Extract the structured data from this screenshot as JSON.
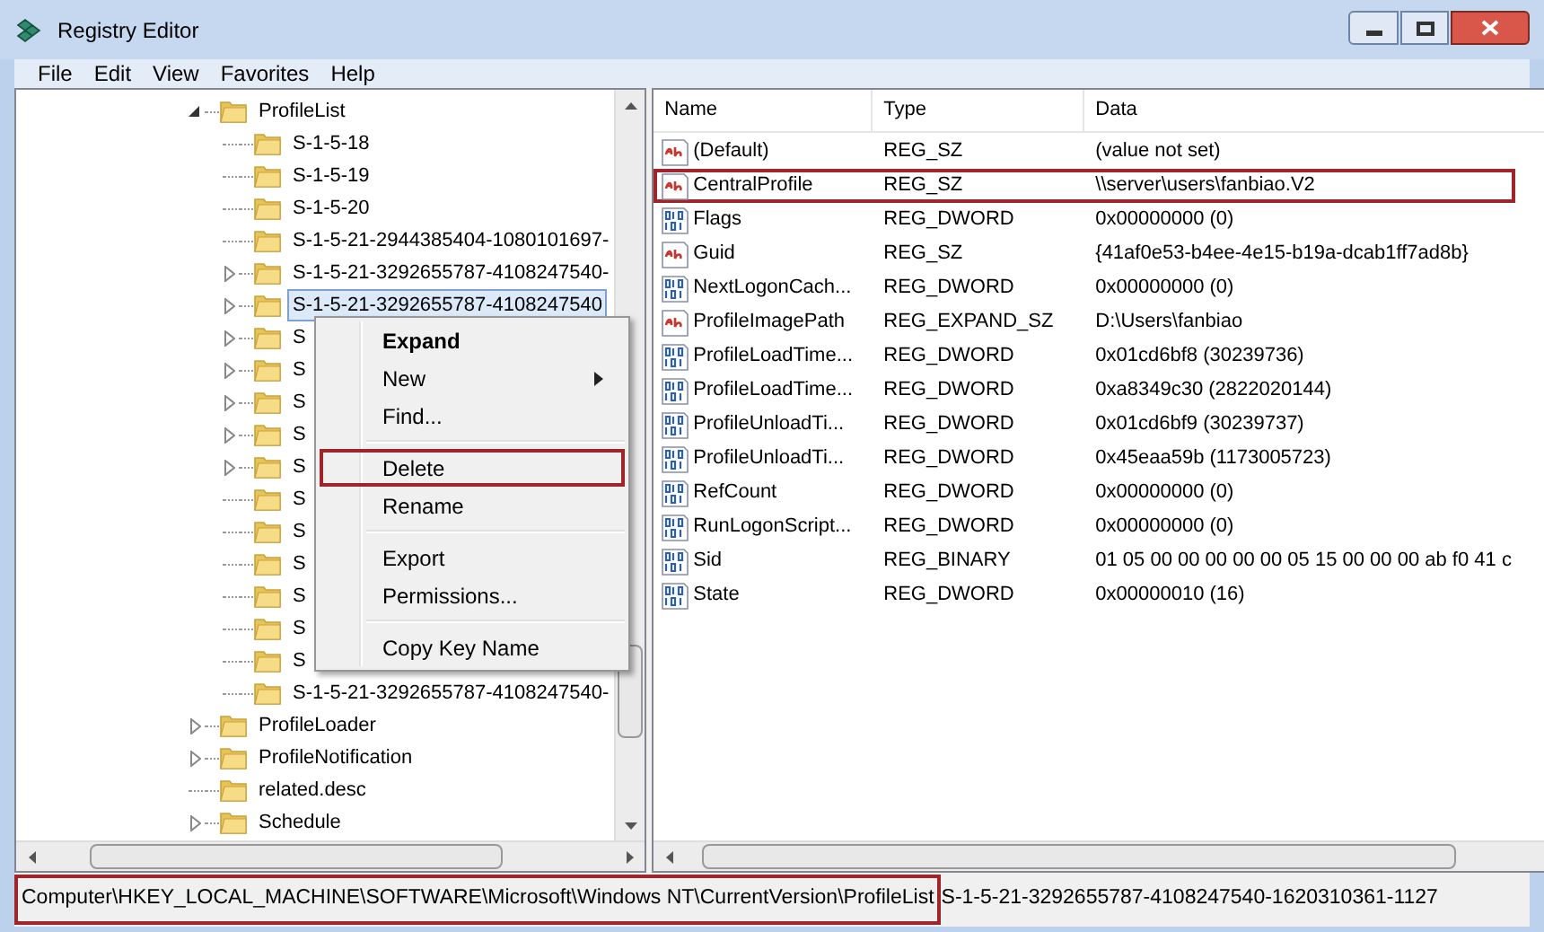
{
  "window": {
    "title": "Registry Editor"
  },
  "menu_bar": [
    "File",
    "Edit",
    "View",
    "Favorites",
    "Help"
  ],
  "tree": [
    {
      "label": "ProfileList",
      "kind": "branch",
      "expanded": true,
      "selected": false,
      "children": [
        {
          "label": "S-1-5-18",
          "kind": "leaf",
          "selected": false
        },
        {
          "label": "S-1-5-19",
          "kind": "leaf",
          "selected": false
        },
        {
          "label": "S-1-5-20",
          "kind": "leaf",
          "selected": false
        },
        {
          "label": "S-1-5-21-2944385404-1080101697-",
          "kind": "leaf",
          "selected": false
        },
        {
          "label": "S-1-5-21-3292655787-4108247540-",
          "kind": "branch",
          "expanded": false,
          "selected": false
        },
        {
          "label": "S-1-5-21-3292655787-4108247540",
          "kind": "branch",
          "expanded": false,
          "selected": true
        },
        {
          "label": "S",
          "kind": "branch",
          "expanded": false,
          "selected": false
        },
        {
          "label": "S",
          "kind": "branch",
          "expanded": false,
          "selected": false
        },
        {
          "label": "S",
          "kind": "branch",
          "expanded": false,
          "selected": false
        },
        {
          "label": "S",
          "kind": "branch",
          "expanded": false,
          "selected": false
        },
        {
          "label": "S",
          "kind": "branch",
          "expanded": false,
          "selected": false
        },
        {
          "label": "S",
          "kind": "leaf",
          "selected": false
        },
        {
          "label": "S",
          "kind": "leaf",
          "selected": false
        },
        {
          "label": "S",
          "kind": "leaf",
          "selected": false
        },
        {
          "label": "S",
          "kind": "leaf",
          "selected": false
        },
        {
          "label": "S",
          "kind": "leaf",
          "selected": false
        },
        {
          "label": "S",
          "kind": "leaf",
          "selected": false
        },
        {
          "label": "S-1-5-21-3292655787-4108247540-",
          "kind": "leaf",
          "selected": false
        }
      ]
    },
    {
      "label": "ProfileLoader",
      "kind": "branch",
      "expanded": false,
      "selected": false
    },
    {
      "label": "ProfileNotification",
      "kind": "branch",
      "expanded": false,
      "selected": false
    },
    {
      "label": "related.desc",
      "kind": "leaf",
      "selected": false
    },
    {
      "label": "Schedule",
      "kind": "branch",
      "expanded": false,
      "selected": false
    }
  ],
  "context_menu": [
    {
      "kind": "item",
      "label": "Expand",
      "bold": true,
      "submenu": false,
      "highlighted": false
    },
    {
      "kind": "item",
      "label": "New",
      "bold": false,
      "submenu": true,
      "highlighted": false
    },
    {
      "kind": "item",
      "label": "Find...",
      "bold": false,
      "submenu": false,
      "highlighted": false
    },
    {
      "kind": "separator"
    },
    {
      "kind": "item",
      "label": "Delete",
      "bold": false,
      "submenu": false,
      "highlighted": true
    },
    {
      "kind": "item",
      "label": "Rename",
      "bold": false,
      "submenu": false,
      "highlighted": false
    },
    {
      "kind": "separator"
    },
    {
      "kind": "item",
      "label": "Export",
      "bold": false,
      "submenu": false,
      "highlighted": false
    },
    {
      "kind": "item",
      "label": "Permissions...",
      "bold": false,
      "submenu": false,
      "highlighted": false
    },
    {
      "kind": "separator"
    },
    {
      "kind": "item",
      "label": "Copy Key Name",
      "bold": false,
      "submenu": false,
      "highlighted": false
    }
  ],
  "values_table": {
    "columns": [
      "Name",
      "Type",
      "Data"
    ],
    "rows": [
      {
        "kind": "string",
        "name": "(Default)",
        "type": "REG_SZ",
        "data": "(value not set)",
        "highlighted": false
      },
      {
        "kind": "string",
        "name": "CentralProfile",
        "type": "REG_SZ",
        "data": "\\\\server\\users\\fanbiao.V2",
        "highlighted": true
      },
      {
        "kind": "binary",
        "name": "Flags",
        "type": "REG_DWORD",
        "data": "0x00000000 (0)",
        "highlighted": false
      },
      {
        "kind": "string",
        "name": "Guid",
        "type": "REG_SZ",
        "data": "{41af0e53-b4ee-4e15-b19a-dcab1ff7ad8b}",
        "highlighted": false
      },
      {
        "kind": "binary",
        "name": "NextLogonCach...",
        "type": "REG_DWORD",
        "data": "0x00000000 (0)",
        "highlighted": false
      },
      {
        "kind": "string",
        "name": "ProfileImagePath",
        "type": "REG_EXPAND_SZ",
        "data": "D:\\Users\\fanbiao",
        "highlighted": false
      },
      {
        "kind": "binary",
        "name": "ProfileLoadTime...",
        "type": "REG_DWORD",
        "data": "0x01cd6bf8 (30239736)",
        "highlighted": false
      },
      {
        "kind": "binary",
        "name": "ProfileLoadTime...",
        "type": "REG_DWORD",
        "data": "0xa8349c30 (2822020144)",
        "highlighted": false
      },
      {
        "kind": "binary",
        "name": "ProfileUnloadTi...",
        "type": "REG_DWORD",
        "data": "0x01cd6bf9 (30239737)",
        "highlighted": false
      },
      {
        "kind": "binary",
        "name": "ProfileUnloadTi...",
        "type": "REG_DWORD",
        "data": "0x45eaa59b (1173005723)",
        "highlighted": false
      },
      {
        "kind": "binary",
        "name": "RefCount",
        "type": "REG_DWORD",
        "data": "0x00000000 (0)",
        "highlighted": false
      },
      {
        "kind": "binary",
        "name": "RunLogonScript...",
        "type": "REG_DWORD",
        "data": "0x00000000 (0)",
        "highlighted": false
      },
      {
        "kind": "binary",
        "name": "Sid",
        "type": "REG_BINARY",
        "data": "01 05 00 00 00 00 00 05 15 00 00 00 ab f0 41 c",
        "highlighted": false
      },
      {
        "kind": "binary",
        "name": "State",
        "type": "REG_DWORD",
        "data": "0x00000010 (16)",
        "highlighted": false
      }
    ]
  },
  "status_bar": {
    "path": "Computer\\HKEY_LOCAL_MACHINE\\SOFTWARE\\Microsoft\\Windows NT\\CurrentVersion\\ProfileList",
    "path_highlighted": true,
    "rest": "S-1-5-21-3292655787-4108247540-1620310361-1127"
  }
}
